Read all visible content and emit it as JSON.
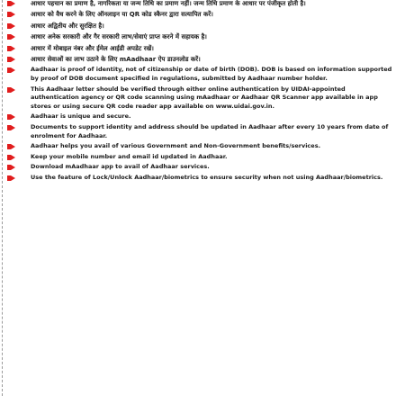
{
  "accent": "#e11d1d",
  "items": [
    {
      "lang": "hi",
      "text": "आधार पहचान का प्रमाण है, नागरिकता या जन्म तिथि का प्रमाण नहीं। जन्म तिथि प्रमाण के आधार पर पंजीकृत होती है।"
    },
    {
      "lang": "hi",
      "text": "आधार को वैध करने के लिए ऑनलाइन या QR कोड स्कैनर द्वारा सत्यापित करें।"
    },
    {
      "lang": "hi",
      "text": "आधार अद्वितीय और सुरक्षित है।"
    },
    {
      "lang": "hi",
      "text": "आधार अनेक सरकारी और गैर सरकारी लाभ/सेवाएं प्राप्त करने में सहायक है।"
    },
    {
      "lang": "hi",
      "text": "आधार में मोबाइल नंबर और ईमेल आईडी अपडेट रखें।"
    },
    {
      "lang": "hi",
      "text": "आधार सेवाओं का लाभ उठाने के लिए mAadhaar ऐप डाउनलोड करें।"
    },
    {
      "lang": "en",
      "text": "Aadhaar is proof of identity, not of citizenship or date of birth (DOB). DOB is based on information supported by proof of DOB document specified in regulations, submitted by Aadhaar number holder."
    },
    {
      "lang": "en",
      "text": "This Aadhaar letter should be verified through either online authentication by UIDAI-appointed authentication agency or QR code scanning using mAadhaar or Aadhaar QR Scanner app available in app stores or using secure QR code reader app available on www.uidai.gov.in."
    },
    {
      "lang": "en",
      "text": "Aadhaar is unique and secure."
    },
    {
      "lang": "en",
      "text": "Documents to support identity and address should be updated in Aadhaar after every 10 years from date of enrolment for Aadhaar."
    },
    {
      "lang": "en",
      "text": "Aadhaar helps you avail of various Government and Non-Government benefits/services."
    },
    {
      "lang": "en",
      "text": "Keep your mobile number and email id updated in Aadhaar."
    },
    {
      "lang": "en",
      "text": "Download mAadhaar app to avail of Aadhaar services."
    },
    {
      "lang": "en",
      "text": "Use the feature of Lock/Unlock Aadhaar/biometrics to ensure security when not using Aadhaar/biometrics."
    }
  ]
}
